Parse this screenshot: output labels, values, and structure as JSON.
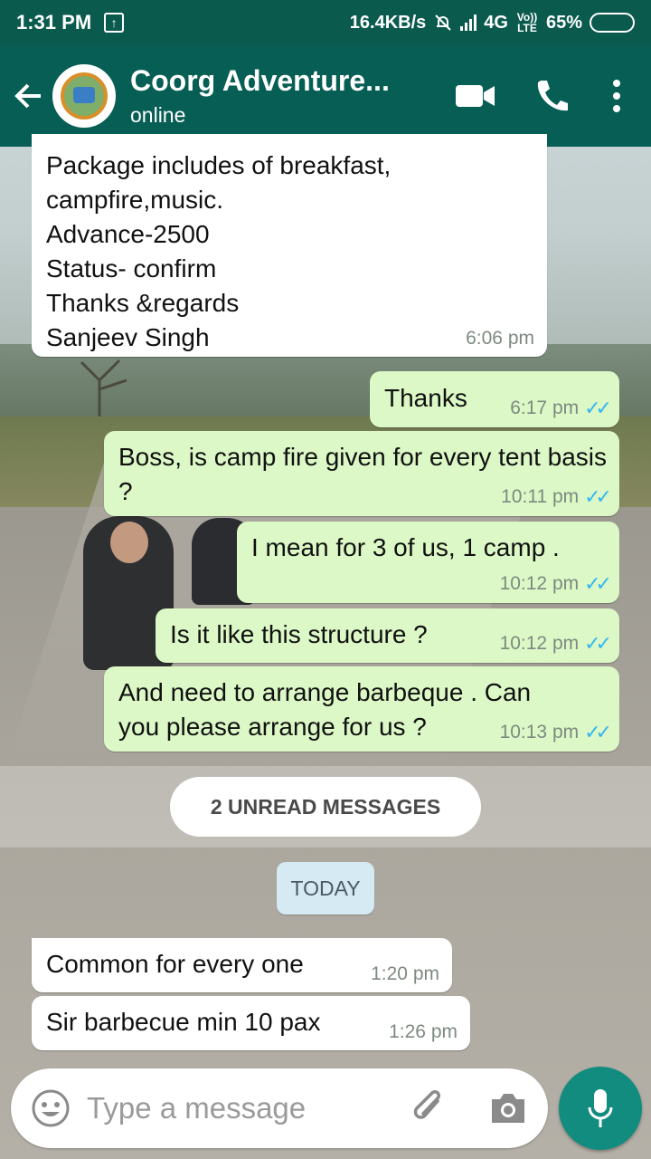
{
  "status_bar": {
    "time": "1:31 PM",
    "upload_icon": "upload-arrow-icon",
    "net_speed": "16.4KB/s",
    "network": "4G",
    "volte": "Vo)) LTE",
    "battery": "65%",
    "battery_level": 0.65
  },
  "header": {
    "title": "Coorg Adventure...",
    "subtitle": "online",
    "colors": {
      "primary": "#075e54",
      "status": "#0b5a4e",
      "accent": "#128c7e"
    }
  },
  "messages": [
    {
      "dir": "in",
      "lines": [
        "Package includes of breakfast,",
        "campfire,music.",
        "Advance-2500",
        "Status- confirm",
        "Thanks &regards",
        "Sanjeev Singh"
      ],
      "time": "6:06 pm"
    },
    {
      "dir": "out",
      "text": "Thanks",
      "time": "6:17 pm",
      "ticks": "✓✓"
    },
    {
      "dir": "out",
      "text": "Boss, is camp fire given for every tent basis ?",
      "time": "10:11 pm",
      "ticks": "✓✓"
    },
    {
      "dir": "out",
      "text": "I mean for 3 of us, 1 camp .",
      "time": "10:12 pm",
      "ticks": "✓✓"
    },
    {
      "dir": "out",
      "text": "Is it like this structure ?",
      "time": "10:12 pm",
      "ticks": "✓✓"
    },
    {
      "dir": "out",
      "text": "And need to arrange barbeque . Can you please arrange for us ?",
      "time": "10:13 pm",
      "ticks": "✓✓"
    },
    {
      "dir": "in",
      "text": "Common for every one",
      "time": "1:20 pm"
    },
    {
      "dir": "in",
      "text": "Sir barbecue min 10 pax",
      "time": "1:26 pm"
    }
  ],
  "unread_label": "2 UNREAD MESSAGES",
  "date_label": "TODAY",
  "composer": {
    "placeholder": "Type a message"
  }
}
